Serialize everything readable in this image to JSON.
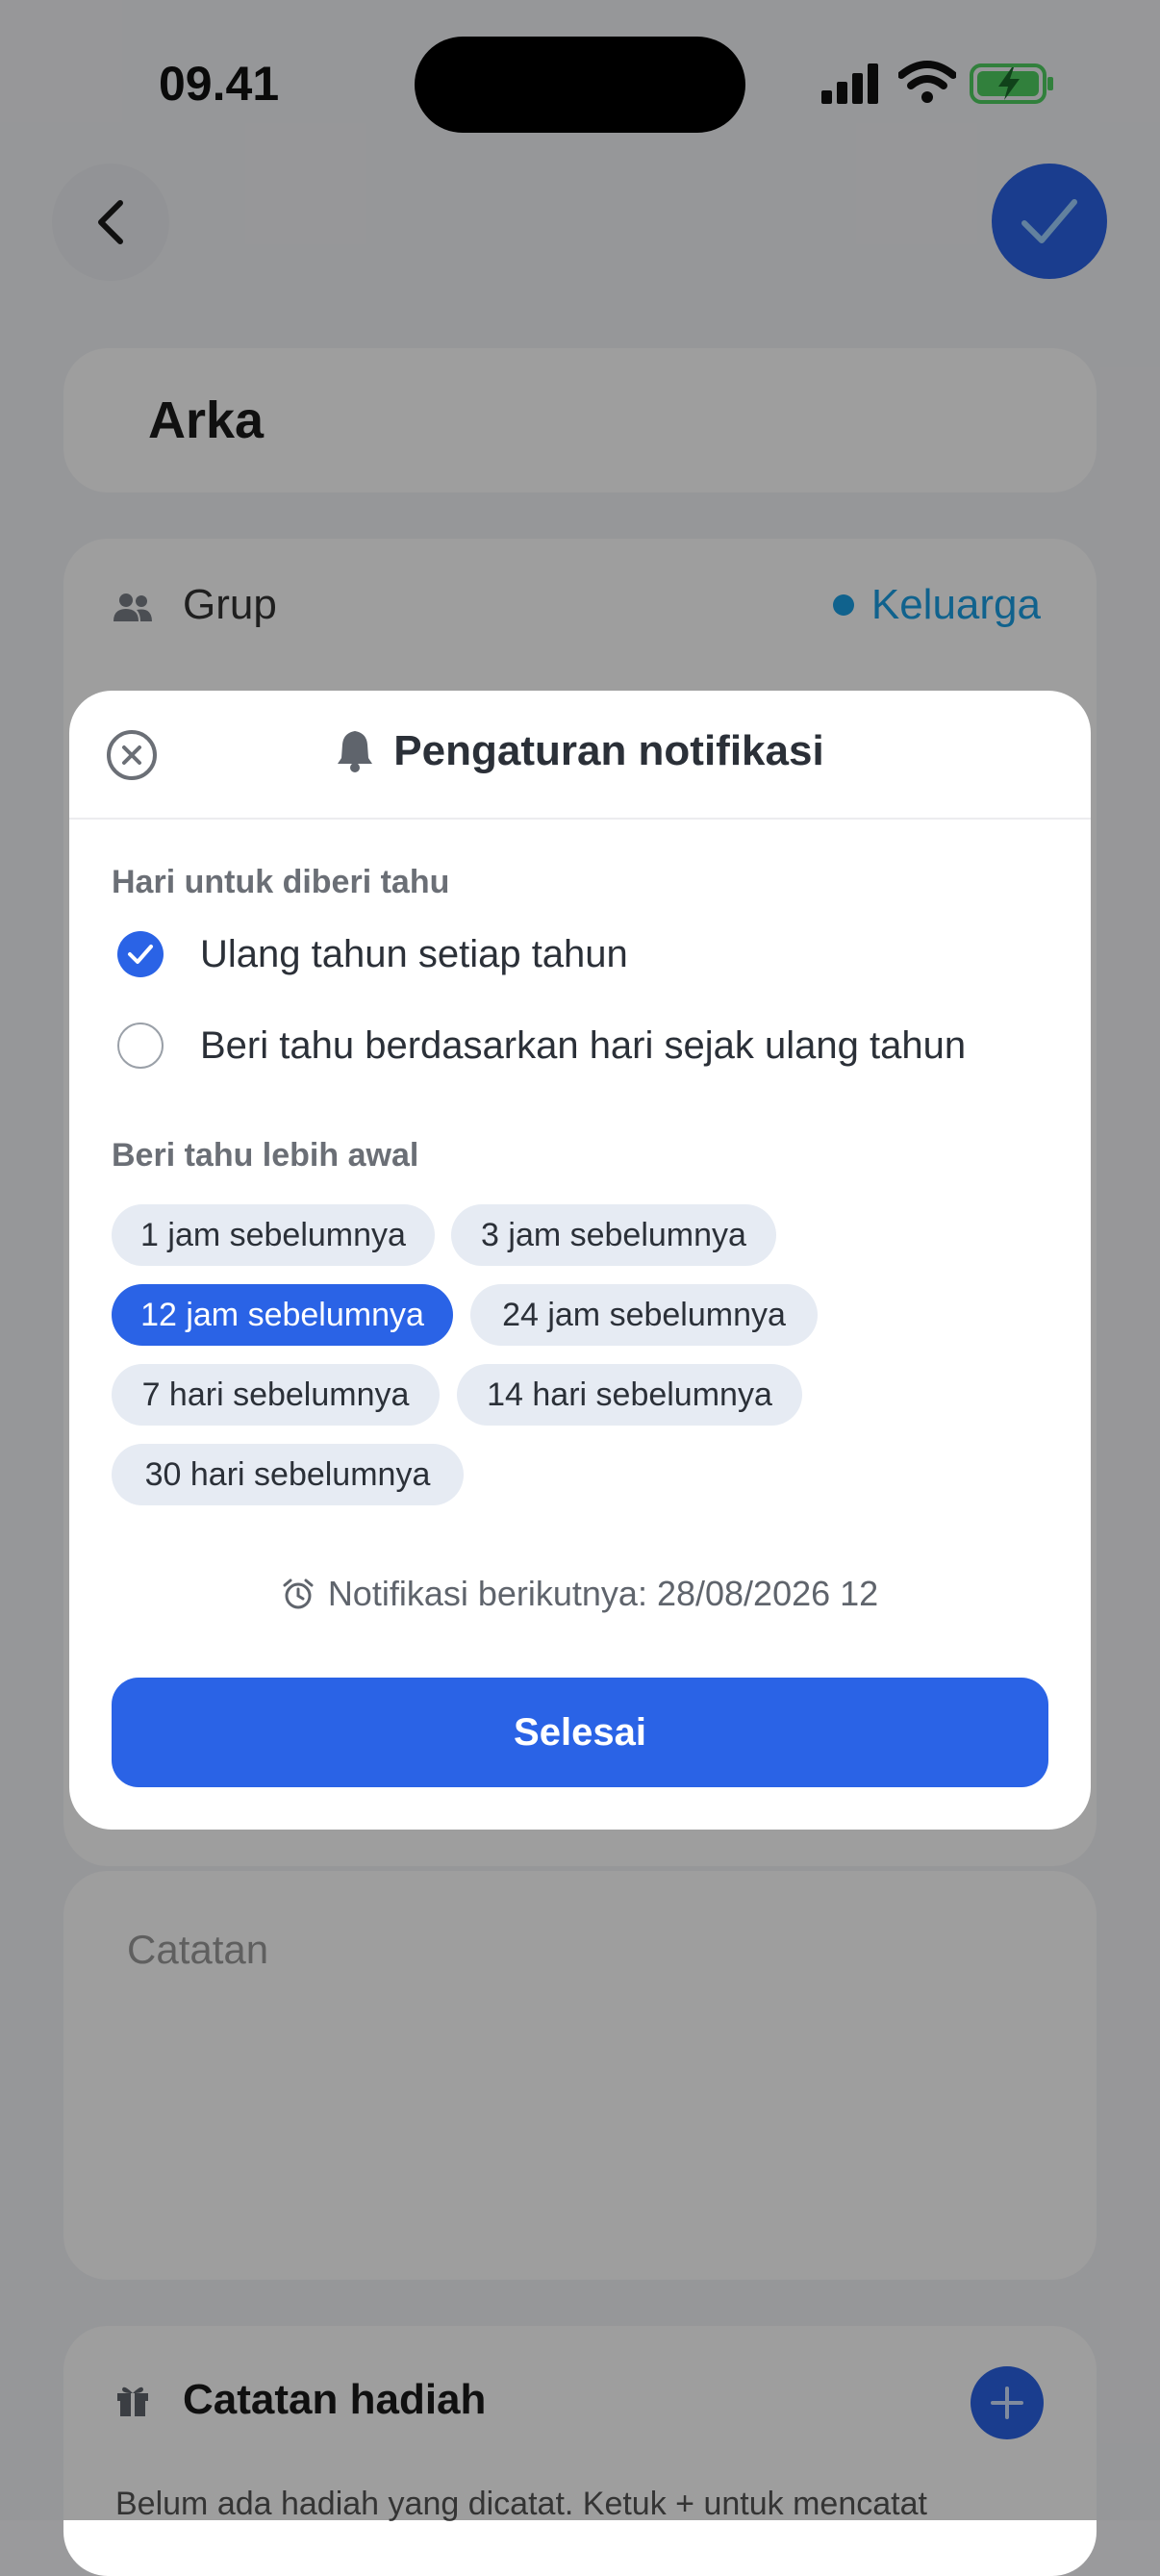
{
  "status_bar": {
    "time": "09.41"
  },
  "contact": {
    "name": "Arka"
  },
  "group": {
    "label": "Grup",
    "value": "Keluarga",
    "dot_color": "#1a9fe4"
  },
  "notes": {
    "placeholder": "Catatan"
  },
  "gifts": {
    "title": "Catatan hadiah",
    "empty_text": "Belum ada hadiah yang dicatat. Ketuk + untuk mencatat"
  },
  "modal": {
    "title": "Pengaturan notifikasi",
    "day_section_label": "Hari untuk diberi tahu",
    "day_options": [
      {
        "label": "Ulang tahun setiap tahun",
        "selected": true
      },
      {
        "label": "Beri tahu berdasarkan hari sejak ulang tahun",
        "selected": false
      }
    ],
    "early_section_label": "Beri tahu lebih awal",
    "early_options": [
      {
        "label": "1 jam sebelumnya",
        "selected": false
      },
      {
        "label": "3 jam sebelumnya",
        "selected": false
      },
      {
        "label": "12 jam sebelumnya",
        "selected": true
      },
      {
        "label": "24 jam sebelumnya",
        "selected": false
      },
      {
        "label": "7 hari sebelumnya",
        "selected": false
      },
      {
        "label": "14 hari sebelumnya",
        "selected": false
      },
      {
        "label": "30 hari sebelumnya",
        "selected": false
      }
    ],
    "next_notification": "Notifikasi berikutnya: 28/08/2026 12",
    "done_label": "Selesai"
  },
  "colors": {
    "accent": "#2a63e6",
    "chip_bg": "#e6ebf3",
    "group_accent": "#1a9fe4"
  },
  "icons": [
    "back-icon",
    "check-icon",
    "people-icon",
    "close-icon",
    "bell-icon",
    "alarm-icon",
    "gift-icon",
    "plus-icon"
  ]
}
